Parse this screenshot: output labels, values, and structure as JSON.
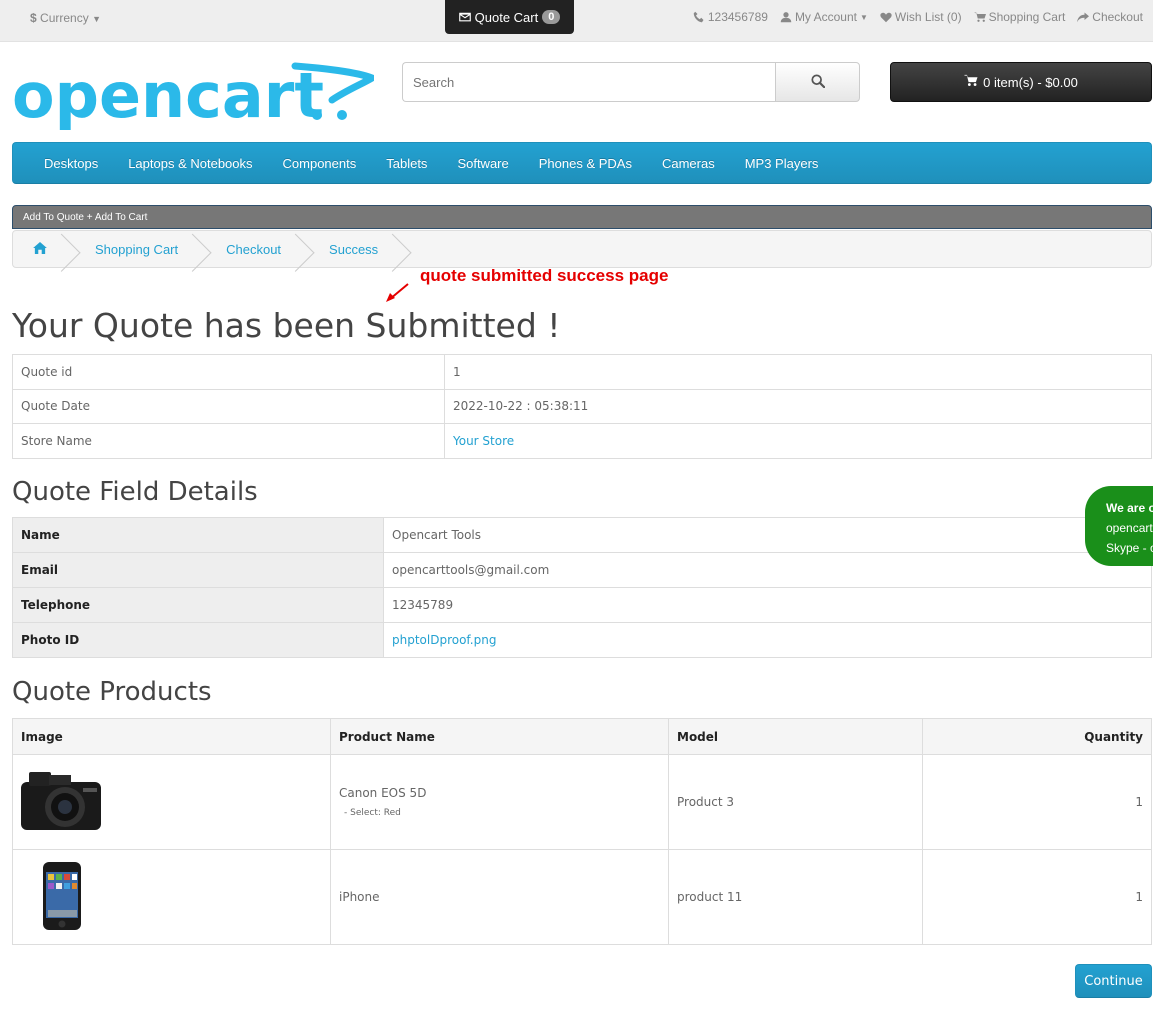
{
  "colors": {
    "accent": "#23a1d1",
    "annotation": "#e50000",
    "chat_bg": "#1a8f1a",
    "dark_button": "#222222"
  },
  "topbar": {
    "currency": "Currency",
    "quote_cart_label": "Quote Cart",
    "quote_cart_count": "0",
    "phone": "123456789",
    "my_account": "My Account",
    "wish_list": "Wish List (0)",
    "shopping_cart": "Shopping Cart",
    "checkout": "Checkout"
  },
  "header": {
    "logo_text": "opencart",
    "search_placeholder": "Search",
    "cart_summary": "0 item(s) - $0.00"
  },
  "menu": {
    "items": [
      "Desktops",
      "Laptops & Notebooks",
      "Components",
      "Tablets",
      "Software",
      "Phones & PDAs",
      "Cameras",
      "MP3 Players"
    ]
  },
  "quote_bar_label": "Add To Quote + Add To Cart",
  "breadcrumb": {
    "items": [
      "Shopping Cart",
      "Checkout",
      "Success"
    ]
  },
  "annotation": "quote submitted success page",
  "page_title": "Your Quote has been Submitted !",
  "quote_info": [
    {
      "label": "Quote id",
      "value": "1"
    },
    {
      "label": "Quote Date",
      "value": "2022-10-22 : 05:38:11"
    },
    {
      "label": "Store Name",
      "value": "Your Store"
    }
  ],
  "field_details": {
    "title": "Quote Field Details",
    "rows": [
      {
        "label": "Name",
        "value": "Opencart Tools"
      },
      {
        "label": "Email",
        "value": "opencarttools@gmail.com"
      },
      {
        "label": "Telephone",
        "value": "12345789"
      },
      {
        "label": "Photo ID",
        "value": "phptolDproof.png"
      }
    ]
  },
  "products": {
    "title": "Quote Products",
    "headers": {
      "image": "Image",
      "name": "Product Name",
      "model": "Model",
      "quantity": "Quantity"
    },
    "rows": [
      {
        "name": "Canon EOS 5D",
        "option": "- Select: Red",
        "model": "Product 3",
        "quantity": "1",
        "image_icon": "camera-image"
      },
      {
        "name": "iPhone",
        "option": "",
        "model": "product 11",
        "quantity": "1",
        "image_icon": "phone-image"
      }
    ]
  },
  "chat": {
    "line1": "We are o",
    "line2": "opencart",
    "line3": "Skype - o"
  },
  "continue_label": "Continue"
}
